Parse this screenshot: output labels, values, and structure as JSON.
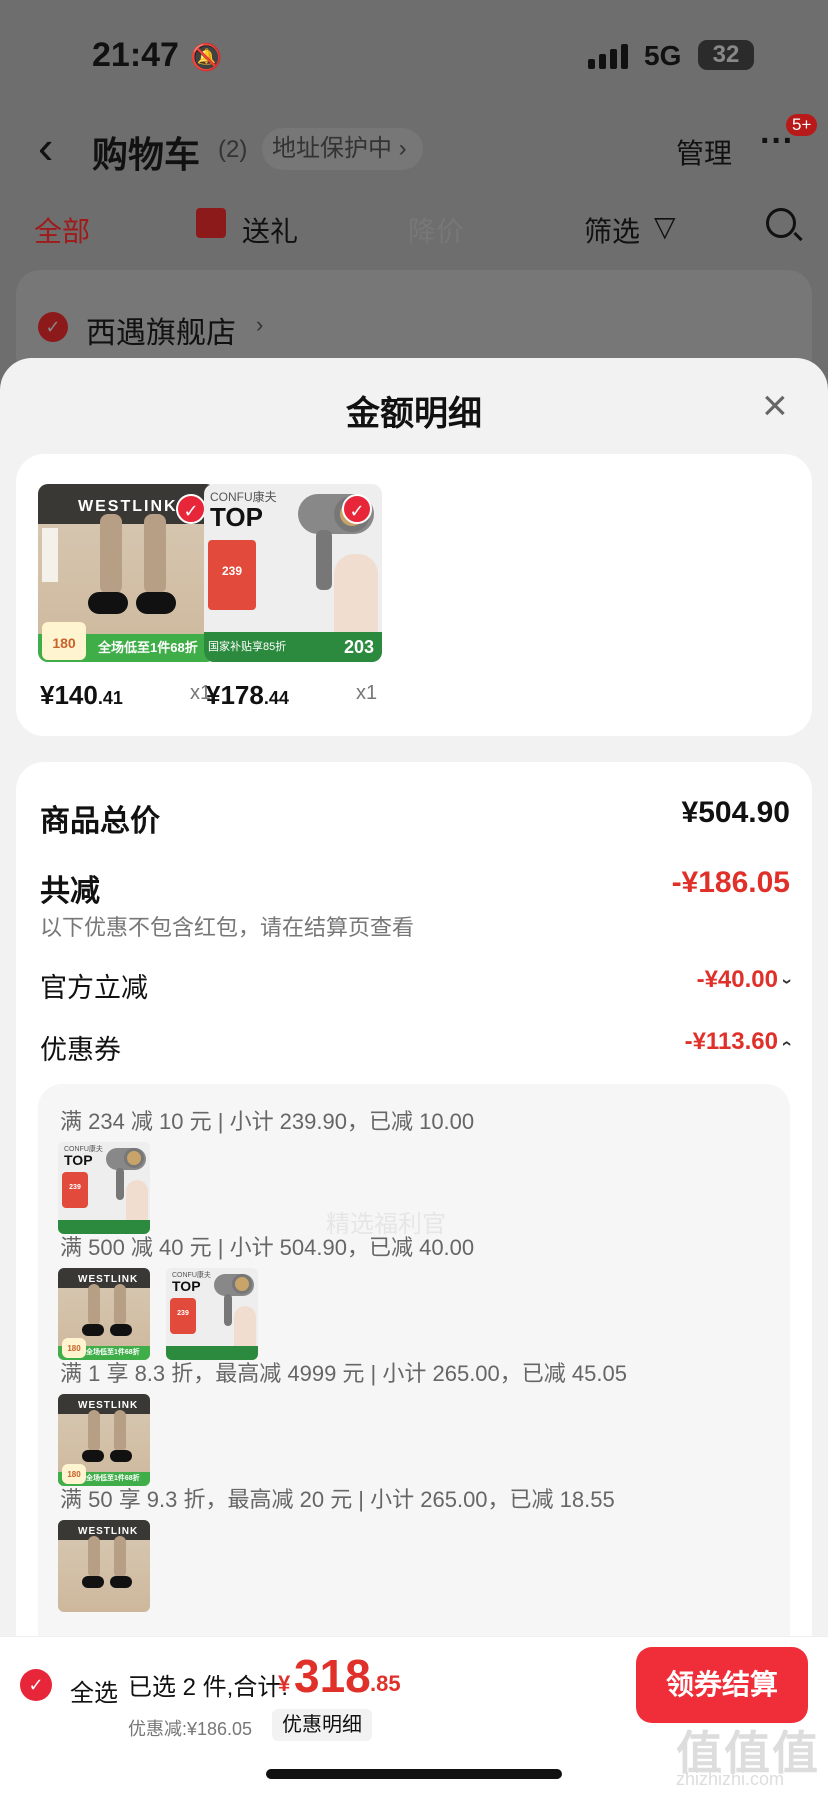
{
  "status_bar": {
    "time": "21:47",
    "network": "5G",
    "battery": "32"
  },
  "nav": {
    "title": "购物车",
    "count": "(2)",
    "address_protect": "地址保护中 ›",
    "manage": "管理",
    "more": "···",
    "badge": "5+"
  },
  "tabs": {
    "all": "全部",
    "gift": "送礼",
    "price_drop": "降价",
    "filter": "筛选",
    "filter_icon": "▽"
  },
  "store": {
    "name": "西遇旗舰店",
    "arrow": "›"
  },
  "sheet": {
    "title": "金额明细",
    "close": "×",
    "goods": [
      {
        "brand": "WESTLINK",
        "price_int": "¥140",
        "price_dec": ".41",
        "qty": "x1",
        "banner": "全场低至1件68折",
        "badge": "180"
      },
      {
        "brand_logo": "CONFU康夫",
        "top": "TOP",
        "price_int": "¥178",
        "price_dec": ".44",
        "qty": "x1",
        "banner": "国家补贴享85折",
        "badge_price": "203",
        "promo": "239"
      }
    ]
  },
  "summary": {
    "total_label": "商品总价",
    "total_value": "¥504.90",
    "reduce_label": "共减",
    "reduce_value": "-¥186.05",
    "note": "以下优惠不包含红包，请在结算页查看",
    "official_label": "官方立减",
    "official_value": "-¥40.00",
    "official_chev": "›",
    "coupon_label": "优惠券",
    "coupon_value": "-¥113.60",
    "coupon_chev": "‹",
    "watermark": "精选福利官"
  },
  "coupons": [
    {
      "text": "满 234 减 10 元 | 小计 239.90，已减 10.00"
    },
    {
      "text": "满 500 减 40 元 | 小计 504.90，已减 40.00"
    },
    {
      "text": "满 1 享 8.3 折，最高减 4999 元 | 小计 265.00，已减 45.05"
    },
    {
      "text": "满 50 享 9.3 折，最高减 20 元 | 小计 265.00，已减 18.55"
    }
  ],
  "bottom": {
    "select_all": "全选",
    "selected": "已选 2 件,合计:",
    "yen": "¥",
    "total_int": "318",
    "total_dec": ".85",
    "discount": "优惠减:¥186.05",
    "detail": "优惠明细",
    "pay": "领券结算",
    "site_mark": "值值值",
    "site_url": "zhizhizhi.com"
  },
  "colors": {
    "accent": "#e0302a",
    "pay_button": "#f02e3a",
    "check": "#e7263a"
  }
}
